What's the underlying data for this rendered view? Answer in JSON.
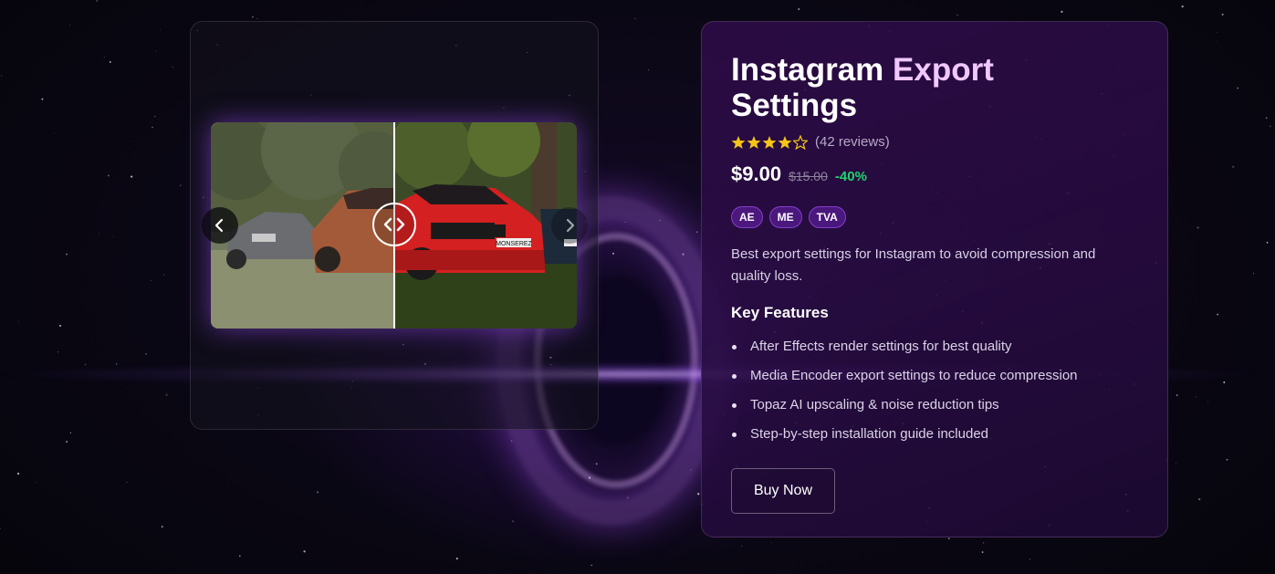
{
  "product": {
    "title_part1": "Instagram Export",
    "title_part2": "Settings",
    "rating": 4,
    "rating_max": 5,
    "reviews_text": "(42 reviews)",
    "price": "$9.00",
    "old_price": "$15.00",
    "discount": "-40%",
    "tags": [
      "AE",
      "ME",
      "TVA"
    ],
    "description": "Best export settings for Instagram to avoid compression and quality loss.",
    "features_heading": "Key Features",
    "features": [
      "After Effects render settings for best quality",
      "Media Encoder export settings to reduce compression",
      "Topaz AI upscaling & noise reduction tips",
      "Step-by-step installation guide included"
    ],
    "buy_label": "Buy Now"
  },
  "comparison": {
    "slider_position": 0.5,
    "before_plate": "",
    "after_plate": "MONSEREZ"
  },
  "colors": {
    "accent_title": "#f0c8ff",
    "star": "#f5c518",
    "discount": "#22d36b",
    "tag_bg": "#5a1e96"
  },
  "icons": {
    "prev": "chevron-left-icon",
    "next": "chevron-right-icon",
    "handle": "drag-handle-icon",
    "star": "star-icon"
  }
}
